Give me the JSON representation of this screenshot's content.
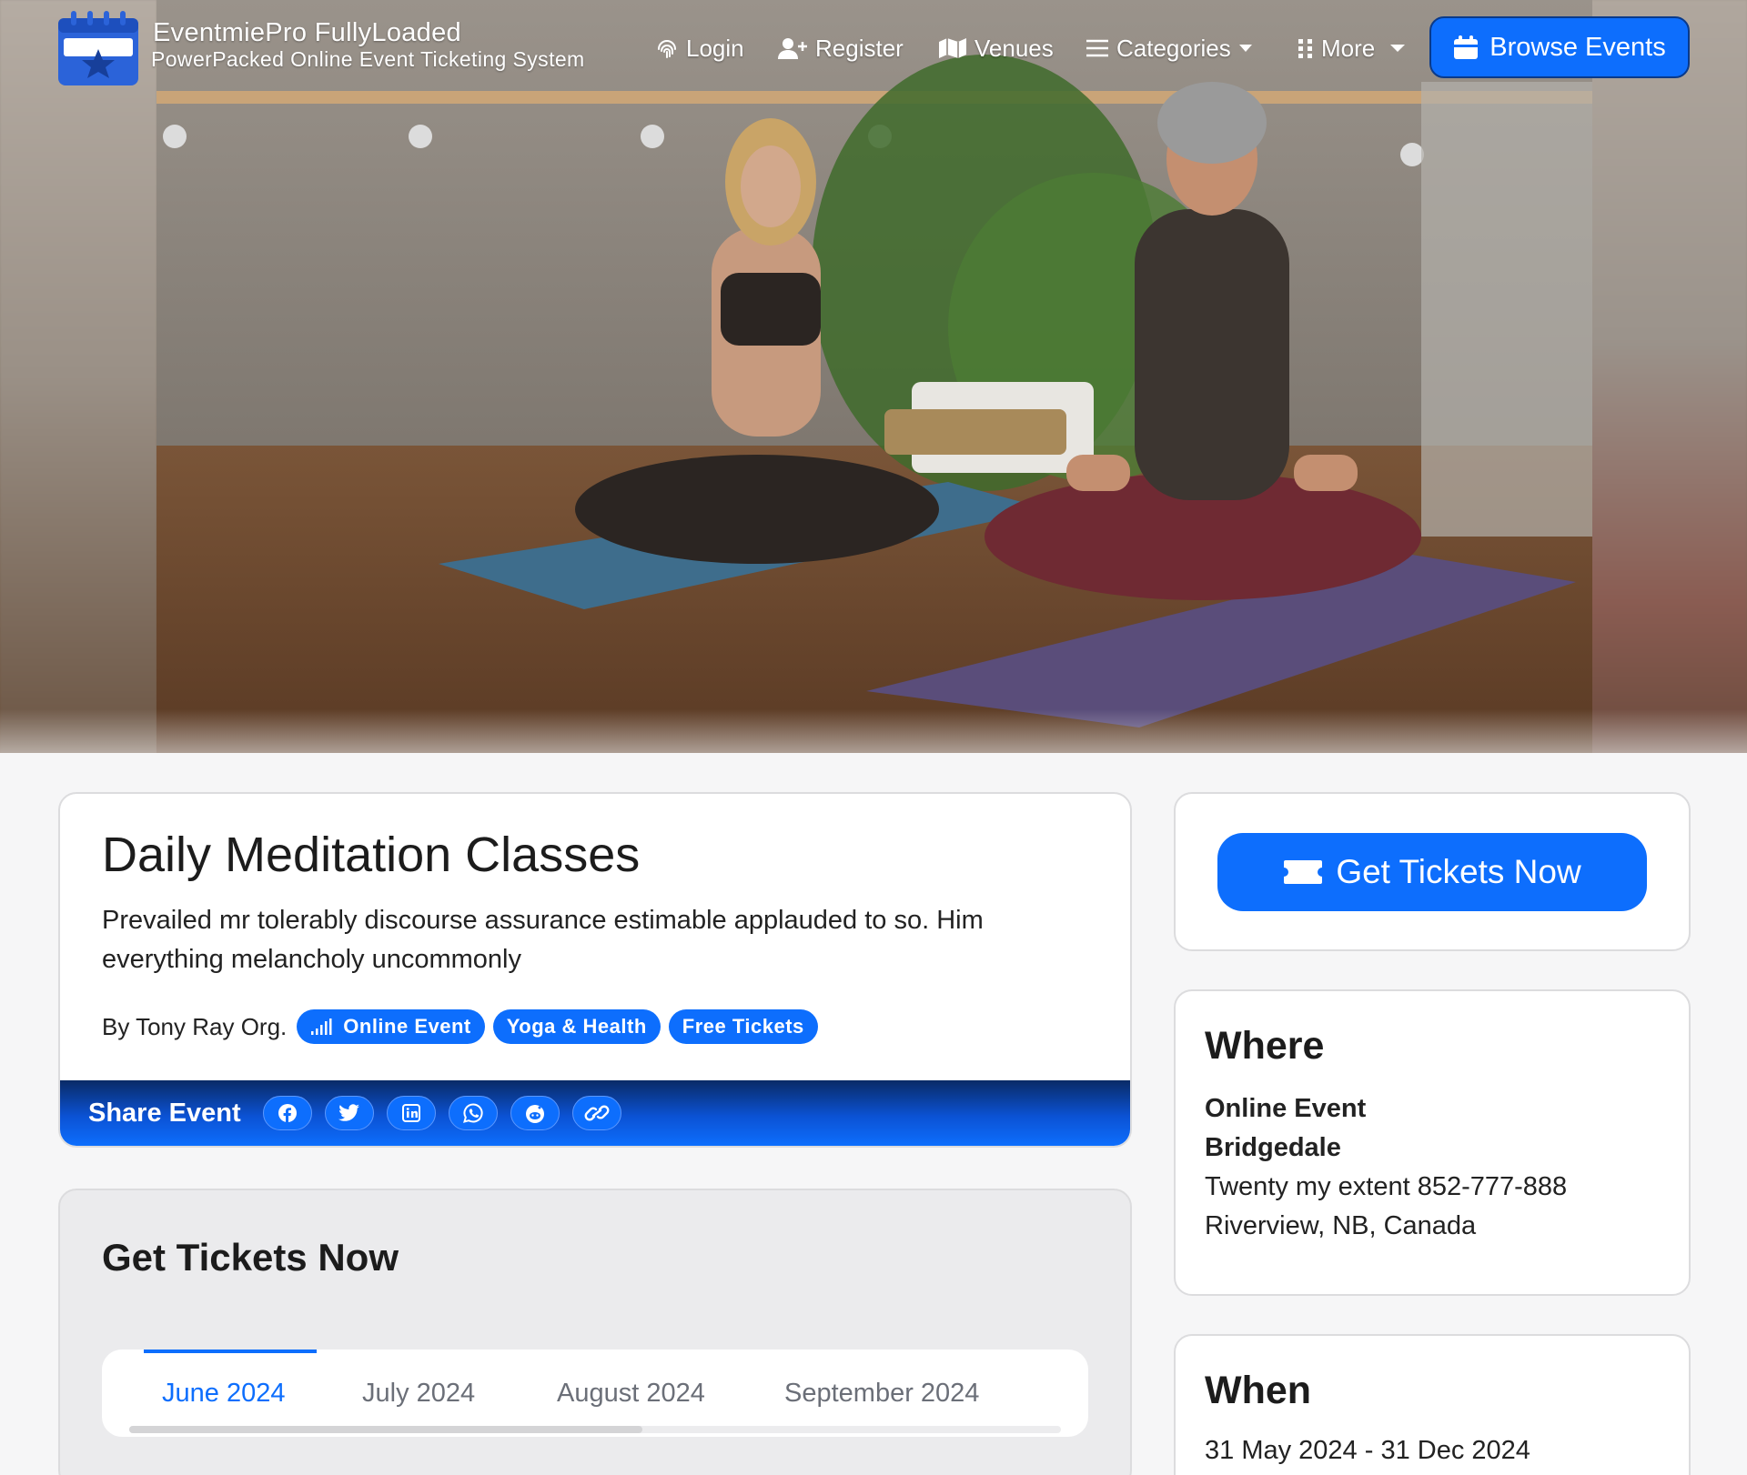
{
  "brand": {
    "title": "EventmiePro FullyLoaded",
    "subtitle": "PowerPacked Online Event Ticketing System"
  },
  "nav": {
    "login": "Login",
    "register": "Register",
    "venues": "Venues",
    "categories": "Categories",
    "more": "More",
    "browse_events": "Browse Events"
  },
  "event": {
    "title": "Daily Meditation Classes",
    "description": "Prevailed mr tolerably discourse assurance estimable applauded to so. Him everything melancholy uncommonly",
    "organizer": "By Tony Ray Org.",
    "badges": [
      "Online Event",
      "Yoga & Health",
      "Free Tickets"
    ]
  },
  "share": {
    "label": "Share Event",
    "icons": [
      "facebook-icon",
      "twitter-icon",
      "linkedin-icon",
      "whatsapp-icon",
      "reddit-icon",
      "link-icon"
    ]
  },
  "tickets": {
    "title": "Get Tickets Now",
    "tabs": [
      "June 2024",
      "July 2024",
      "August 2024",
      "September 2024"
    ],
    "active_tab": "June 2024"
  },
  "sidebar": {
    "get_tickets_button": "Get Tickets Now",
    "where": {
      "heading": "Where",
      "venue_type": "Online Event",
      "venue_name": "Bridgedale",
      "address_line": "Twenty my extent 852-777-888",
      "city_line": "Riverview, NB, Canada"
    },
    "when": {
      "heading": "When",
      "dates": "31 May 2024 - 31 Dec 2024"
    }
  },
  "colors": {
    "accent": "#0d6efd",
    "share_bar_dark": "#0a2a66"
  }
}
